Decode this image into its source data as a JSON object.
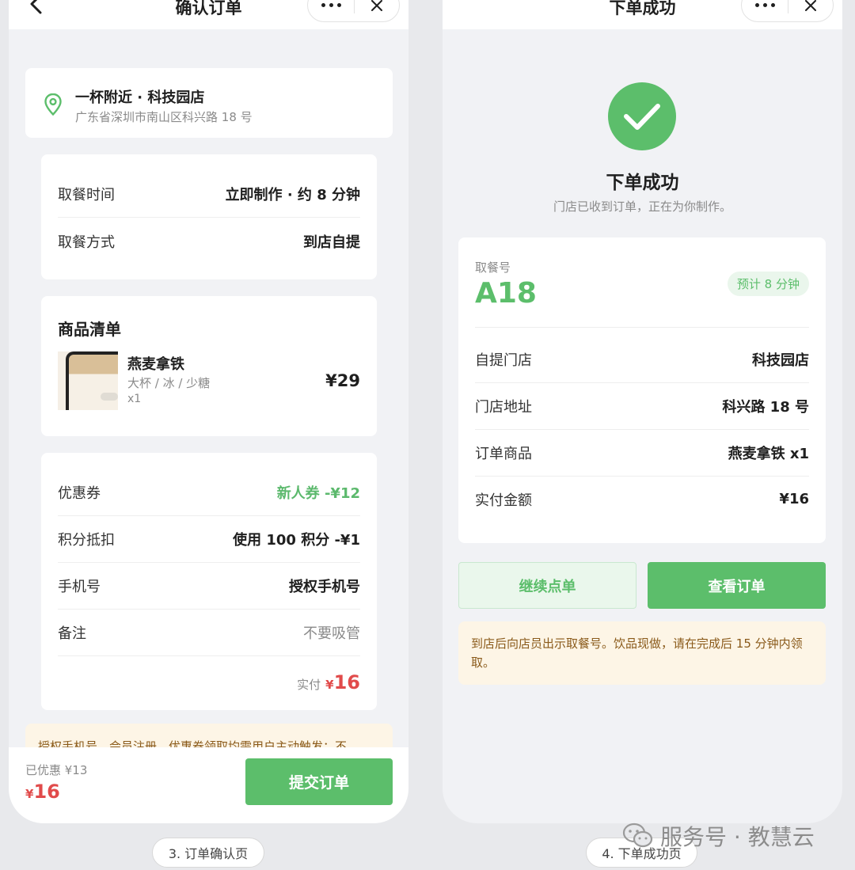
{
  "left": {
    "nav_title": "确认订单",
    "store": {
      "name": "一杯附近 · 科技园店",
      "address": "广东省深圳市南山区科兴路 18 号"
    },
    "pickup": [
      {
        "label": "取餐时间",
        "value": "立即制作 · 约 8 分钟"
      },
      {
        "label": "取餐方式",
        "value": "到店自提"
      }
    ],
    "goods": {
      "title": "商品清单",
      "name": "燕麦拿铁",
      "spec": "大杯 / 冰 / 少糖",
      "qty": "x1",
      "price": "¥29"
    },
    "fees": [
      {
        "label": "优惠券",
        "value": "新人券 -¥12"
      },
      {
        "label": "积分抵扣",
        "value": "使用 100 积分 -¥1"
      },
      {
        "label": "手机号",
        "value": "授权手机号"
      },
      {
        "label": "备注",
        "value": "不要吸管"
      }
    ],
    "total": {
      "label": "实付",
      "currency": "¥",
      "amount": "16"
    },
    "notice_peek": "授权手机号、会员注册、优惠券领取均需用户主动触发；不",
    "bottom": {
      "saved": "已优惠 ¥13",
      "currency": "¥",
      "amount": "16",
      "submit": "提交订单"
    },
    "caption": "3. 订单确认页"
  },
  "right": {
    "nav_title": "下单成功",
    "success_title": "下单成功",
    "success_sub": "门店已收到订单，正在为你制作。",
    "pick_label": "取餐号",
    "pick_no": "A18",
    "eta": "预计 8 分钟",
    "rows": [
      {
        "label": "自提门店",
        "value": "科技园店"
      },
      {
        "label": "门店地址",
        "value": "科兴路 18 号"
      },
      {
        "label": "订单商品",
        "value": "燕麦拿铁 x1"
      },
      {
        "label": "实付金额",
        "value": "¥16"
      }
    ],
    "btn_continue": "继续点单",
    "btn_view": "查看订单",
    "tip": "到店后向店员出示取餐号。饮品现做，请在完成后 15 分钟内领取。",
    "caption": "4. 下单成功页"
  },
  "watermark": "服务号 · 教慧云",
  "colors": {
    "accent": "#5cbe6b",
    "price_red": "#e14b4b",
    "notice_bg": "#fdf5e6"
  }
}
